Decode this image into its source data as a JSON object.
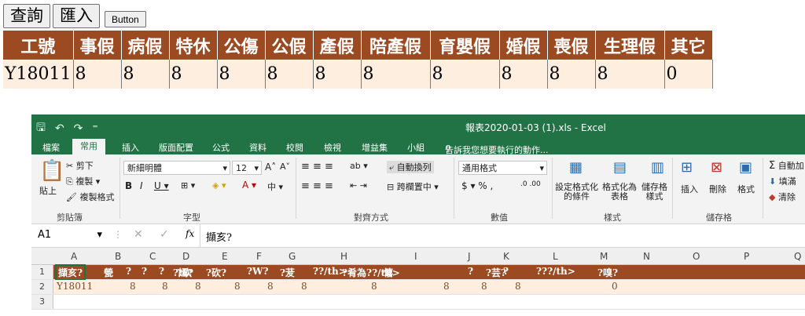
{
  "buttons": {
    "query": "查詢",
    "import": "匯入",
    "button": "Button"
  },
  "web_table": {
    "headers": [
      "工號",
      "事假",
      "病假",
      "特休",
      "公傷",
      "公假",
      "產假",
      "陪產假",
      "育嬰假",
      "婚假",
      "喪假",
      "生理假",
      "其它"
    ],
    "row": [
      "Y18011",
      "8",
      "8",
      "8",
      "8",
      "8",
      "8",
      "8",
      "8",
      "8",
      "8",
      "8",
      "0"
    ]
  },
  "excel": {
    "title": "報表2020-01-03 (1).xls - Excel",
    "tabs": [
      "檔案",
      "常用",
      "插入",
      "版面配置",
      "公式",
      "資料",
      "校閱",
      "檢視",
      "增益集",
      "小組"
    ],
    "tell_me": "告訴我您想要執行的動作...",
    "clipboard": {
      "cut": "剪下",
      "copy": "複製",
      "paste": "貼上",
      "format_painter": "複製格式",
      "label": "剪貼簿"
    },
    "font": {
      "name": "新細明體",
      "size": "12",
      "label": "字型"
    },
    "alignment": {
      "wrap": "自動換列",
      "merge": "跨欄置中",
      "label": "對齊方式"
    },
    "number": {
      "format": "通用格式",
      "label": "數值"
    },
    "styles": {
      "cond": "設定格式化\n的條件",
      "table": "格式化為\n表格",
      "cell": "儲存格\n樣式",
      "label": "樣式"
    },
    "cells": {
      "insert": "插入",
      "delete": "刪除",
      "format": "格式",
      "label": "儲存格"
    },
    "editing": {
      "autosum": "自動加",
      "fill": "填滿",
      "clear": "清除"
    },
    "name_box": "A1",
    "formula": "擷亥?",
    "columns": [
      "A",
      "B",
      "C",
      "D",
      "E",
      "F",
      "G",
      "H",
      "I",
      "J",
      "K",
      "L",
      "M",
      "N",
      "O",
      "P",
      "Q"
    ],
    "rows": [
      "1",
      "2",
      "3"
    ],
    "row1": [
      "擷亥?",
      "甇",
      "?",
      "?",
      "?",
      "?嫣?",
      "?砍",
      "?砍?",
      "?W?",
      "?茇",
      "??/th>",
      "?肴為??/th>",
      "憘",
      "?",
      "?芸?",
      "?",
      "???/th>",
      "?嗅?"
    ],
    "row2": [
      "Y18011",
      "8",
      "8",
      "8",
      "8",
      "8",
      "8",
      "8",
      "8",
      "8",
      "8",
      "0"
    ]
  }
}
